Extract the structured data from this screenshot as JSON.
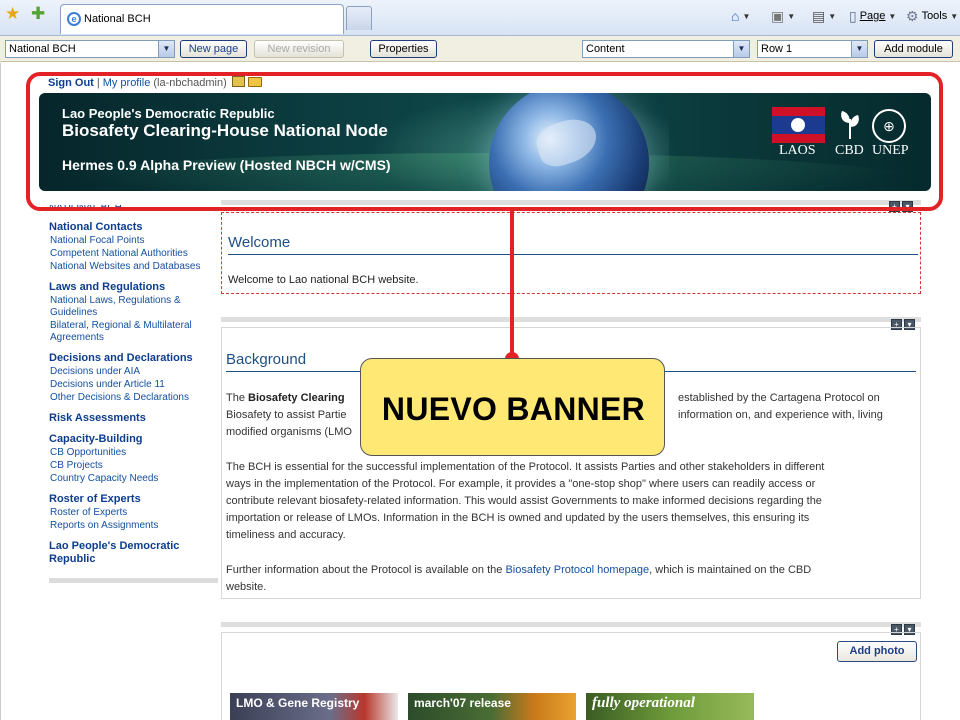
{
  "browser": {
    "tab_title": "National BCH",
    "tab_icon": "e",
    "commands": {
      "page": "Page",
      "tools": "Tools"
    }
  },
  "cms_toolbar": {
    "site_select": "National BCH",
    "new_page": "New page",
    "new_revision": "New revision",
    "properties": "Properties",
    "zone_select": "Content",
    "row_select": "Row 1",
    "add_module": "Add module"
  },
  "userbar": {
    "sign_out": "Sign Out",
    "separator": "|",
    "my_profile": "My profile",
    "username": "(la-nbchadmin)"
  },
  "banner": {
    "country": "Lao People's Democratic Republic",
    "title": "Biosafety Clearing-House National Node",
    "subtitle": "Hermes 0.9 Alpha Preview (Hosted NBCH w/CMS)",
    "logo_laos": "LAOS",
    "logo_cbd": "CBD",
    "logo_unep": "UNEP"
  },
  "sidebar": {
    "top_cut": "NATIONAL BCH",
    "groups": [
      {
        "heading": "National Contacts",
        "items": [
          "National Focal Points",
          "Competent National Authorities",
          "National Websites and Databases"
        ]
      },
      {
        "heading": "Laws and Regulations",
        "items": [
          "National Laws, Regulations & Guidelines",
          "Bilateral, Regional & Multilateral Agreements"
        ]
      },
      {
        "heading": "Decisions and Declarations",
        "items": [
          "Decisions under AIA",
          "Decisions under Article 11",
          "Other Decisions & Declarations"
        ]
      },
      {
        "heading": "Risk Assessments",
        "items": []
      },
      {
        "heading": "Capacity-Building",
        "items": [
          "CB Opportunities",
          "CB Projects",
          "Country Capacity Needs"
        ]
      },
      {
        "heading": "Roster of Experts",
        "items": [
          "Roster of Experts",
          "Reports on Assignments"
        ]
      },
      {
        "heading": "Lao People's Democratic Republic",
        "items": []
      }
    ]
  },
  "welcome": {
    "title": "Welcome",
    "text": "Welcome to Lao national BCH website."
  },
  "background": {
    "title": "Background",
    "p1_lead": "The ",
    "p1_bold": "Biosafety Clearing",
    "p1_line1_tail": "established by the Cartagena Protocol on",
    "p1_line2": "Biosafety to assist Partie",
    "p1_line2_tail": "information on, and experience with, living",
    "p1_line3": "modified organisms (LMO",
    "p2_l1": "The BCH is essential for the successful implementation of the Protocol. It assists Parties and other stakeholders in different",
    "p2_l2": "ways in the implementation of the Protocol. For example, it provides a \"one-stop shop\" where users can readily access or",
    "p2_l3": "contribute relevant biosafety-related information. This would assist Governments to make informed decisions regarding the",
    "p2_l4": "importation or release of LMOs. Information in the BCH is owned and updated by the users themselves, this ensuring its",
    "p2_l5": "timeliness and accuracy.",
    "p3_lead": "Further information about the Protocol is available on the ",
    "p3_link": "Biosafety Protocol homepage",
    "p3_tail": ", which is maintained on the CBD",
    "p3_l2": "website."
  },
  "photos": {
    "add_photo": "Add photo",
    "thumbs": [
      "LMO & Gene Registry",
      "march'07 release",
      "fully operational"
    ]
  },
  "callout": {
    "text": "NUEVO BANNER"
  },
  "colors": {
    "annotation_red": "#e32227",
    "callout_yellow": "#ffe974",
    "heading_blue": "#1d4f86"
  }
}
